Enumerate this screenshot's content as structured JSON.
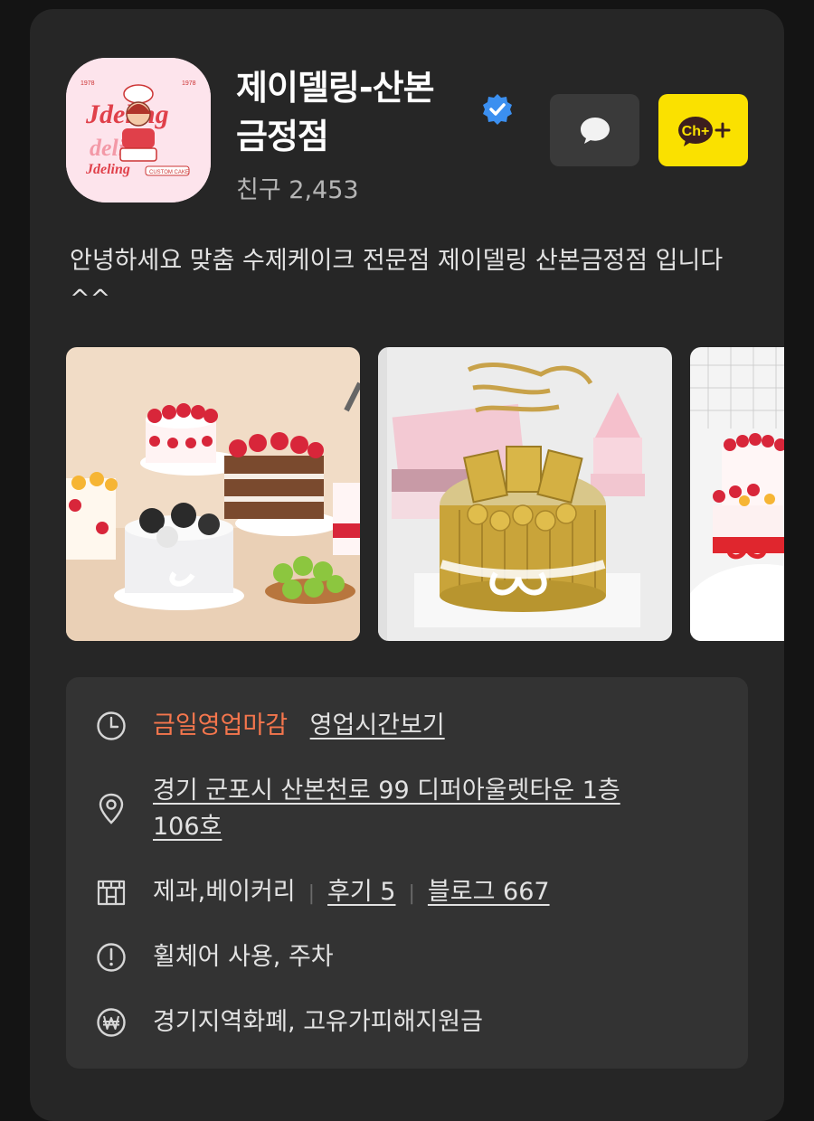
{
  "profile": {
    "name": "제이델링-산본금정점",
    "name_line1": "제이델링-산본",
    "name_line2": "금정점",
    "friends": "친구 2,453",
    "description": "안녕하세요 맞춤 수제케이크 전문점 제이델링 산본금정점 입니다 ^^",
    "logo_text": "Jdeling",
    "logo_subtext": "CUSTOM CAKE"
  },
  "actions": {
    "chat_icon": "speech-bubble-icon",
    "channel_add_label": "Ch+",
    "channel_add_color": "#fae100"
  },
  "photos": [
    {
      "alt": "strawberry cakes assortment"
    },
    {
      "alt": "gold bar cake"
    },
    {
      "alt": "strawberry fruit cake"
    }
  ],
  "info": {
    "hours_status": "금일영업마감",
    "hours_link": "영업시간보기",
    "address_line1": "경기 군포시 산본천로 99 디퍼아울렛타운 1층",
    "address_line2": "106호",
    "category": "제과,베이커리",
    "reviews": "후기 5",
    "blog": "블로그 667",
    "facilities": "휠체어 사용, 주차",
    "payment": "경기지역화폐, 고유가피해지원금",
    "status_color": "#f5764d"
  }
}
